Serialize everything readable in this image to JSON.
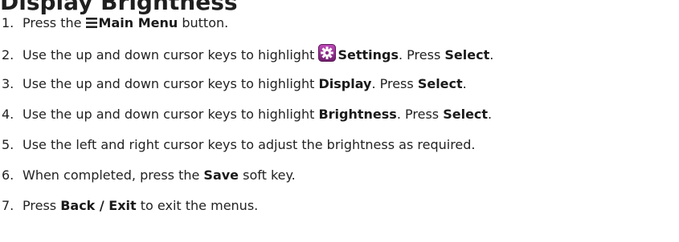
{
  "heading": "Display Brightness",
  "steps": [
    {
      "num": "1.",
      "parts": [
        "Press the ",
        "Main Menu",
        " button."
      ]
    },
    {
      "num": "2.",
      "parts": [
        "Use the up and down cursor keys to highlight ",
        "Settings",
        ". Press ",
        "Select",
        "."
      ]
    },
    {
      "num": "3.",
      "parts": [
        "Use the up and down cursor keys to highlight ",
        "Display",
        ". Press ",
        "Select",
        "."
      ]
    },
    {
      "num": "4.",
      "parts": [
        "Use the up and down cursor keys to highlight ",
        "Brightness",
        ". Press ",
        "Select",
        "."
      ]
    },
    {
      "num": "5.",
      "parts": [
        "Use the left and right cursor keys to adjust the brightness as required."
      ]
    },
    {
      "num": "6.",
      "parts": [
        "When completed, press the ",
        "Save",
        " soft key."
      ]
    },
    {
      "num": "7.",
      "parts": [
        "Press ",
        "Back / Exit",
        " to exit the menus."
      ]
    }
  ],
  "icons": {
    "menu": "main-menu-icon",
    "settings": "settings-gear-icon",
    "settings_color": "#8e2a8a"
  }
}
